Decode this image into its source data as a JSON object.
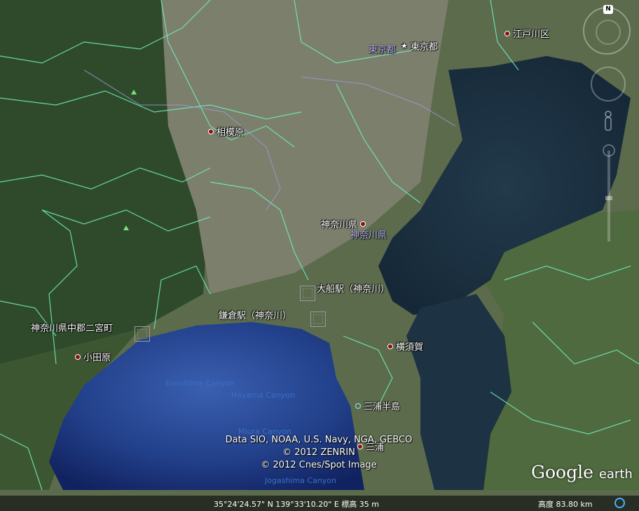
{
  "places": [
    {
      "label": "東京都",
      "kind": "star"
    },
    {
      "label": "江戸川区",
      "kind": "dot"
    },
    {
      "label": "相模原",
      "kind": "dot"
    },
    {
      "label": "神奈川県",
      "kind": "dot"
    },
    {
      "label": "大船駅（神奈川）",
      "kind": "station"
    },
    {
      "label": "鎌倉駅（神奈川）",
      "kind": "station"
    },
    {
      "label": "神奈川県中郡二宮町",
      "kind": "station"
    },
    {
      "label": "小田原",
      "kind": "dot"
    },
    {
      "label": "横須賀",
      "kind": "dot"
    },
    {
      "label": "三浦半島",
      "kind": "circle"
    },
    {
      "label": "三浦",
      "kind": "dot"
    }
  ],
  "sublabels": {
    "tokyo": "東京都",
    "kanagawa": "神奈川県"
  },
  "canyons": [
    "Enoshima Canyon",
    "Hayama Canyon",
    "Miura Canyon",
    "Jogashima Canyon"
  ],
  "credits": [
    "Data SIO, NOAA, U.S. Navy, NGA, GEBCO",
    "© 2012 ZENRIN",
    "© 2012 Cnes/Spot Image"
  ],
  "logo": {
    "google": "Google",
    "earth": "earth"
  },
  "status": {
    "coords": "35°24'24.57\" N 139°33'10.20\" E 標高    35 m",
    "altitude": "高度    83.80 km"
  },
  "navigation": {
    "north_label": "N"
  },
  "colors": {
    "borders": "#6ff0c0",
    "rivers": "#9aa0e0",
    "sea": "#1a2e3e",
    "land": "#3d5a36"
  }
}
